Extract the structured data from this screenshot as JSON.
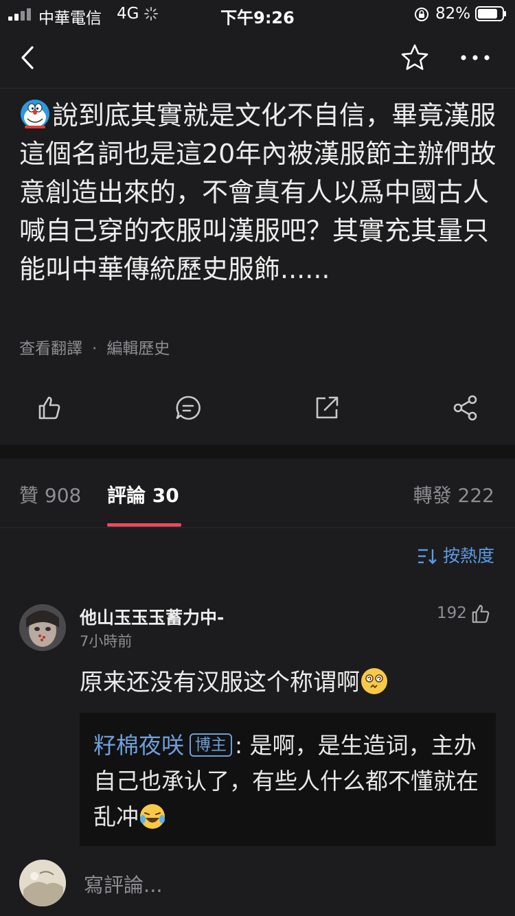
{
  "status_bar": {
    "carrier": "中華電信",
    "network": "4G",
    "time": "下午9:26",
    "battery_percent": "82%",
    "battery_level": 0.82
  },
  "nav": {
    "back_icon": "chevron-left-icon",
    "favorite_icon": "star-icon",
    "more_icon": "more-horizontal-icon"
  },
  "post": {
    "text": "說到底其實就是文化不自信，畢竟漢服這個名詞也是這20年內被漢服節主辦們故意創造出來的，不會真有人以爲中國古人喊自己穿的衣服叫漢服吧？其實充其量只能叫中華傳統歷史服飾......",
    "translate_label": "查看翻譯",
    "separator": "·",
    "history_label": "編輯歷史"
  },
  "actions": {
    "like_icon": "thumbs-up-icon",
    "comment_icon": "comment-icon",
    "repost_icon": "repost-icon",
    "share_icon": "share-icon"
  },
  "tabs": {
    "likes": "贊 908",
    "comments": "評論 30",
    "reposts": "轉發 222"
  },
  "sort": {
    "label": "按熱度"
  },
  "comment": {
    "username": "他山玉玉玉蓄力中-",
    "time": "7小時前",
    "likes": "192",
    "text": "原来还没有汉服这个称谓啊",
    "reply": {
      "username": "籽棉夜咲",
      "badge": "博主",
      "colon": ":",
      "text": "是啊，是生造词，主办自己也承认了，有些人什么都不懂就在乱冲"
    }
  },
  "input": {
    "placeholder": "寫評論..."
  },
  "colors": {
    "background": "#1c1c1e",
    "accent_tab": "#e94b5b",
    "link_blue": "#5b9be6",
    "reply_user": "#6f9fd8"
  }
}
